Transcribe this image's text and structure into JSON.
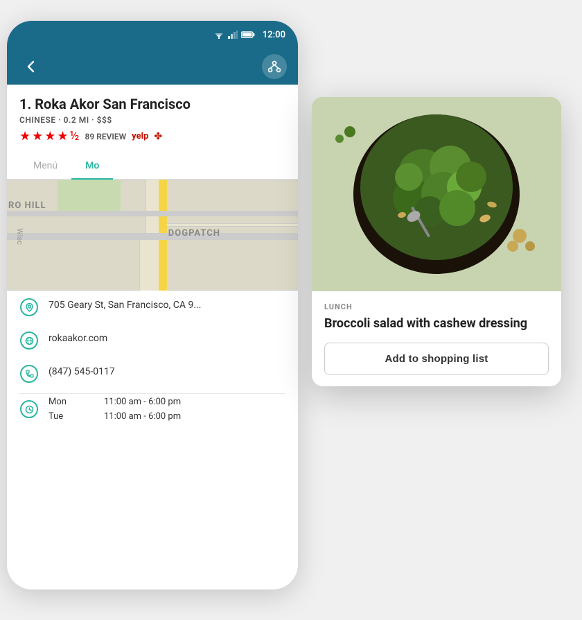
{
  "scene": {
    "background": "#f0f0f0"
  },
  "status_bar": {
    "time": "12:00",
    "background": "#1a6b8a"
  },
  "nav_bar": {
    "back_label": "<",
    "background": "#1a6b8a"
  },
  "restaurant": {
    "name": "1. Roka Akor San Francisco",
    "meta": "CHINESE · 0.2 MI · $$$",
    "review_count": "89 REVIEW",
    "yelp_text": "yelp"
  },
  "tabs": [
    {
      "label": "Menú",
      "active": false
    },
    {
      "label": "Mo",
      "active": true
    }
  ],
  "map": {
    "labels": {
      "ro_hill": "RO HILL",
      "wisc": "Wisc",
      "dogpatch": "DOGPATCH"
    }
  },
  "info_rows": [
    {
      "icon": "location",
      "text": "705 Geary St, San Francisco,  CA 9..."
    },
    {
      "icon": "globe",
      "text": "rokaakor.com"
    },
    {
      "icon": "phone",
      "text": "(847) 545-0117"
    }
  ],
  "hours": [
    {
      "day": "Mon",
      "time": "11:00 am - 6:00 pm"
    },
    {
      "day": "Tue",
      "time": "11:00 am - 6:00 pm"
    }
  ],
  "card": {
    "category": "LUNCH",
    "title": "Broccoli salad with cashew dressing",
    "add_button_label": "Add to shopping list"
  }
}
